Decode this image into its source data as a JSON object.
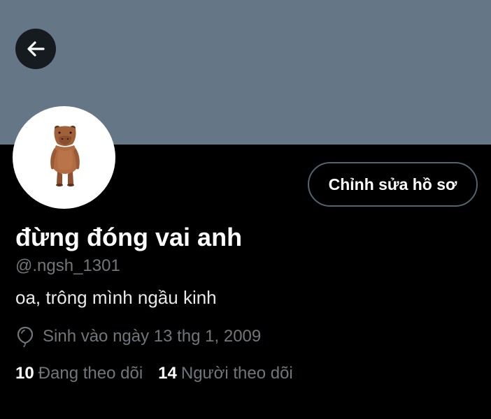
{
  "header": {
    "banner_color": "#657786",
    "back_icon": "arrow-left-icon"
  },
  "profile": {
    "avatar_icon": "capybara-avatar",
    "display_name": "đừng đóng vai anh",
    "handle": "@.ngsh_1301",
    "bio": "oa, trông mình ngầu kinh",
    "birthday_icon": "balloon-icon",
    "birthday": "Sinh vào ngày 13 thg 1, 2009"
  },
  "actions": {
    "edit_profile_label": "Chỉnh sửa hồ sơ"
  },
  "stats": {
    "following_count": "10",
    "following_label": "Đang theo dõi",
    "followers_count": "14",
    "followers_label": "Người theo dõi"
  },
  "colors": {
    "background": "#000000",
    "muted_text": "#71767b",
    "button_border": "#536471"
  }
}
